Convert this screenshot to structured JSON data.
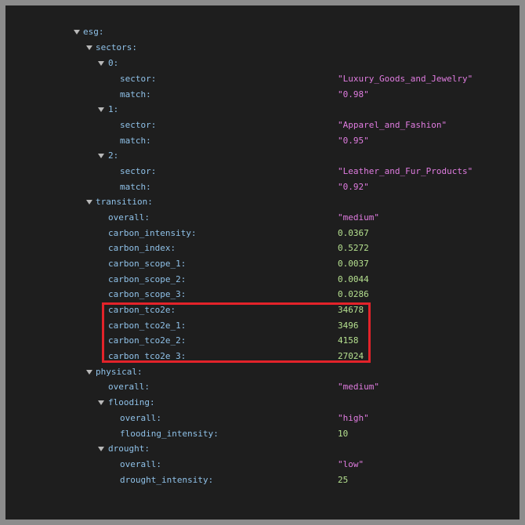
{
  "rows": [
    {
      "key": "esg:",
      "type": "node"
    },
    {
      "key": "sectors:",
      "type": "node"
    },
    {
      "key": "0:",
      "type": "node"
    },
    {
      "key": "sector:",
      "value": "\"Luxury_Goods_and_Jewelry\"",
      "type": "str"
    },
    {
      "key": "match:",
      "value": "\"0.98\"",
      "type": "str"
    },
    {
      "key": "1:",
      "type": "node"
    },
    {
      "key": "sector:",
      "value": "\"Apparel_and_Fashion\"",
      "type": "str"
    },
    {
      "key": "match:",
      "value": "\"0.95\"",
      "type": "str"
    },
    {
      "key": "2:",
      "type": "node"
    },
    {
      "key": "sector:",
      "value": "\"Leather_and_Fur_Products\"",
      "type": "str"
    },
    {
      "key": "match:",
      "value": "\"0.92\"",
      "type": "str"
    },
    {
      "key": "transition:",
      "type": "node"
    },
    {
      "key": "overall:",
      "value": "\"medium\"",
      "type": "str"
    },
    {
      "key": "carbon_intensity:",
      "value": "0.0367",
      "type": "num"
    },
    {
      "key": "carbon_index:",
      "value": "0.5272",
      "type": "num"
    },
    {
      "key": "carbon_scope_1:",
      "value": "0.0037",
      "type": "num"
    },
    {
      "key": "carbon_scope_2:",
      "value": "0.0044",
      "type": "num"
    },
    {
      "key": "carbon_scope_3:",
      "value": "0.0286",
      "type": "num"
    },
    {
      "key": "carbon_tco2e:",
      "value": "34678",
      "type": "num"
    },
    {
      "key": "carbon_tco2e_1:",
      "value": "3496",
      "type": "num"
    },
    {
      "key": "carbon_tco2e_2:",
      "value": "4158",
      "type": "num"
    },
    {
      "key": "carbon_tco2e_3:",
      "value": "27024",
      "type": "num"
    },
    {
      "key": "physical:",
      "type": "node"
    },
    {
      "key": "overall:",
      "value": "\"medium\"",
      "type": "str"
    },
    {
      "key": "flooding:",
      "type": "node"
    },
    {
      "key": "overall:",
      "value": "\"high\"",
      "type": "str"
    },
    {
      "key": "flooding_intensity:",
      "value": "10",
      "type": "num"
    },
    {
      "key": "drought:",
      "type": "node"
    },
    {
      "key": "overall:",
      "value": "\"low\"",
      "type": "str"
    },
    {
      "key": "drought_intensity:",
      "value": "25",
      "type": "num"
    }
  ],
  "colors": {
    "key": "#8fc1e8",
    "string": "#e07ce0",
    "number": "#b5e08f",
    "highlight": "#e3232a"
  }
}
